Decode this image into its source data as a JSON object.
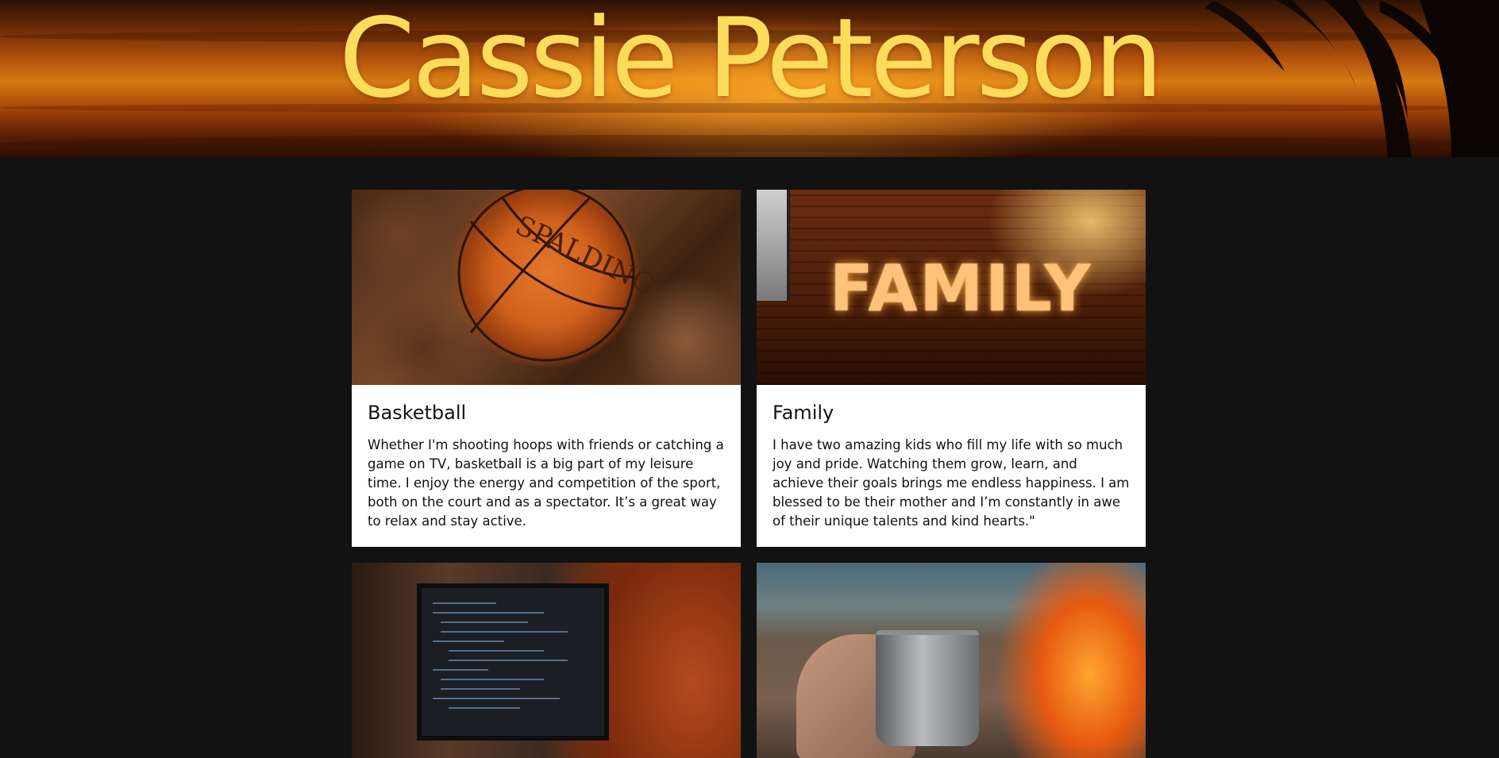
{
  "hero": {
    "title": "Cassie Peterson"
  },
  "cards": [
    {
      "image_alt": "basketball",
      "image_text": "SPALDING",
      "title": "Basketball",
      "text": "Whether I'm shooting hoops with friends or catching a game on TV, basketball is a big part of my leisure time. I enjoy the energy and competition of the sport, both on the court and as a spectator. It’s a great way to relax and stay active."
    },
    {
      "image_alt": "family",
      "image_text": "FAMILY",
      "title": "Family",
      "text": "I have two amazing kids who fill my life with so much joy and pride. Watching them grow, learn, and achieve their goals brings me endless happiness. I am blessed to be their mother and I’m constantly in awe of their unique talents and kind hearts.\""
    },
    {
      "image_alt": "coding"
    },
    {
      "image_alt": "camping"
    }
  ],
  "colors": {
    "background": "#121212",
    "title": "#fddc5c",
    "card": "#ffffff"
  }
}
